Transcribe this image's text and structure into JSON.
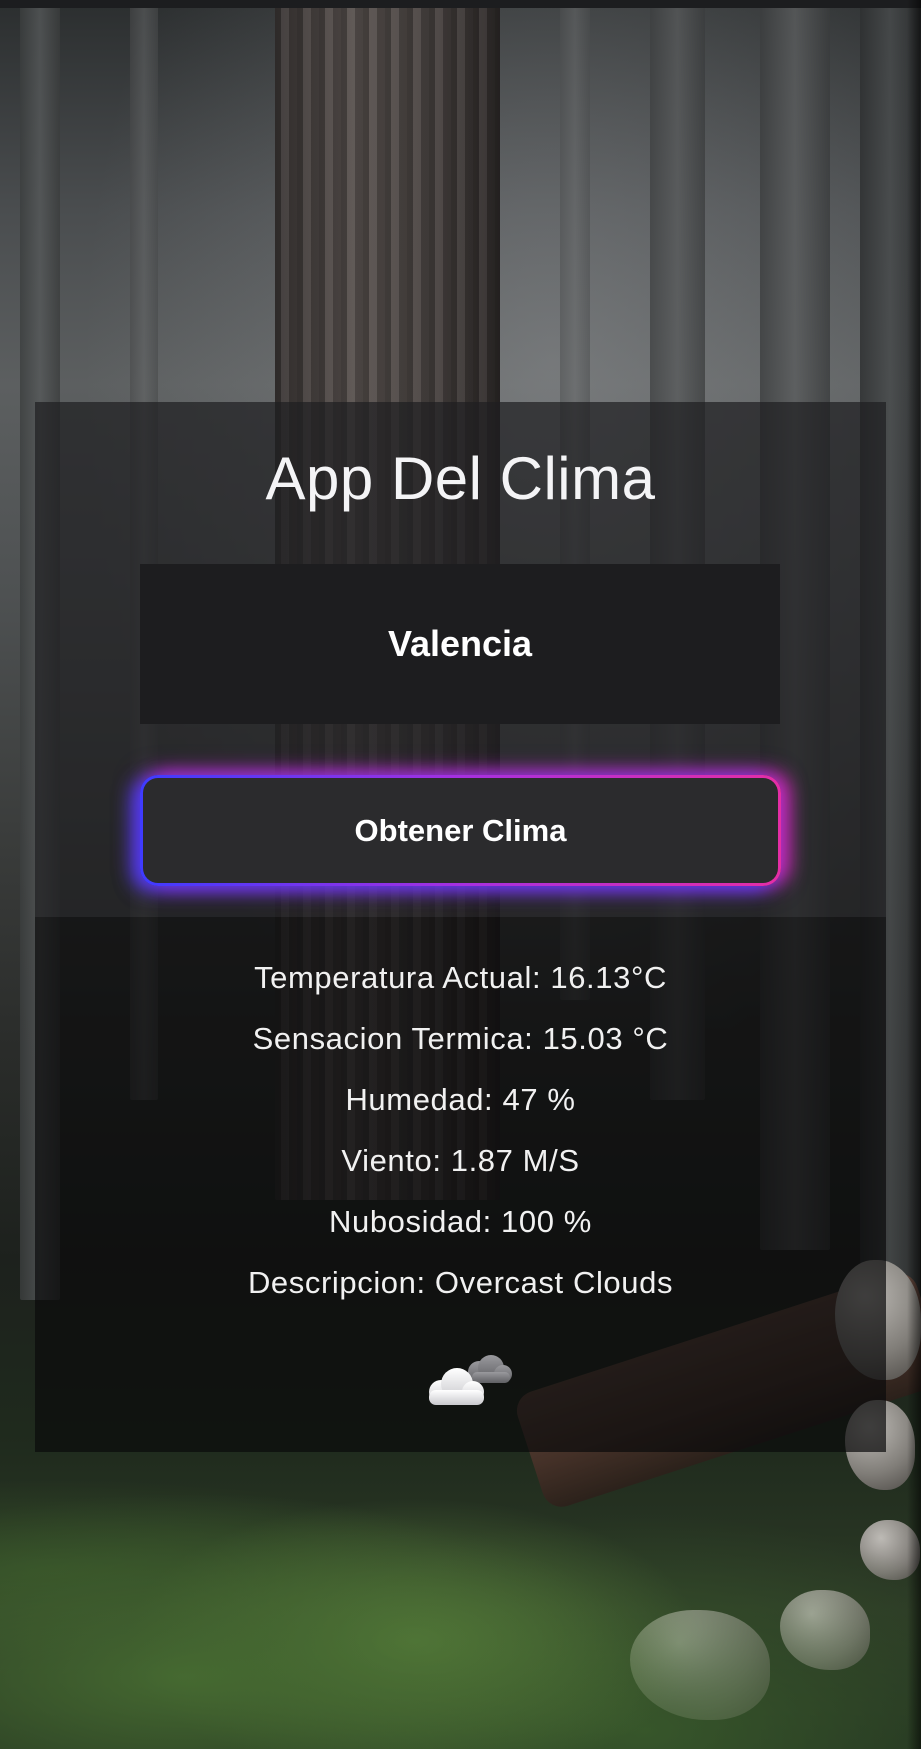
{
  "app": {
    "title": "App Del Clima"
  },
  "search": {
    "value": "Valencia",
    "button_label": "Obtener Clima"
  },
  "weather": {
    "temperature": "Temperatura Actual: 16.13°C",
    "feels_like": "Sensacion Termica: 15.03 °C",
    "humidity": "Humedad: 47 %",
    "wind": "Viento: 1.87 M/S",
    "cloudiness": "Nubosidad: 100 %",
    "description": "Descripcion: Overcast Clouds",
    "icon": "overcast-clouds-icon"
  },
  "colors": {
    "glow_start": "#3f3bff",
    "glow_mid": "#a630e0",
    "glow_end": "#e52ea6",
    "card_bg": "#161618"
  }
}
